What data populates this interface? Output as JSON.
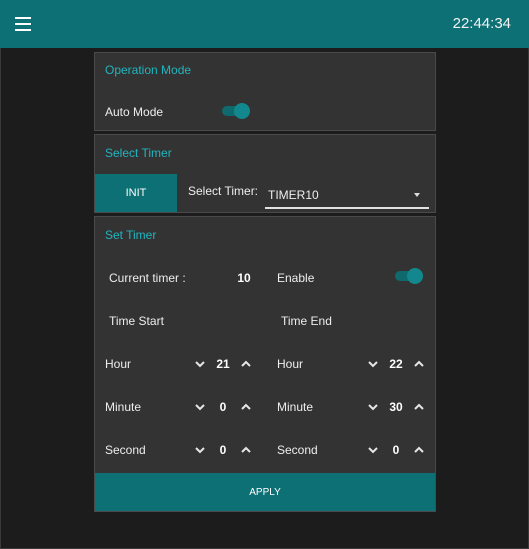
{
  "header": {
    "clock": "22:44:34",
    "menu_icon": "hamburger-menu-icon"
  },
  "operation_mode": {
    "title": "Operation Mode",
    "auto_label": "Auto Mode",
    "auto_on": true
  },
  "select_timer": {
    "title": "Select Timer",
    "init_label": "INIT",
    "select_label": "Select Timer:",
    "selected": "TIMER10"
  },
  "set_timer": {
    "title": "Set Timer",
    "current_label": "Current timer :",
    "current_value": "10",
    "enable_label": "Enable",
    "enabled": true,
    "start_title": "Time Start",
    "end_title": "Time End",
    "start": {
      "hour_label": "Hour",
      "hour": "21",
      "minute_label": "Minute",
      "minute": "0",
      "second_label": "Second",
      "second": "0"
    },
    "end": {
      "hour_label": "Hour",
      "hour": "22",
      "minute_label": "Minute",
      "minute": "30",
      "second_label": "Second",
      "second": "0"
    },
    "apply_label": "APPLY"
  },
  "colors": {
    "accent": "#0d7075",
    "title_text": "#1fb6bf",
    "card_bg": "#333333",
    "page_bg": "#1c1c1c"
  }
}
